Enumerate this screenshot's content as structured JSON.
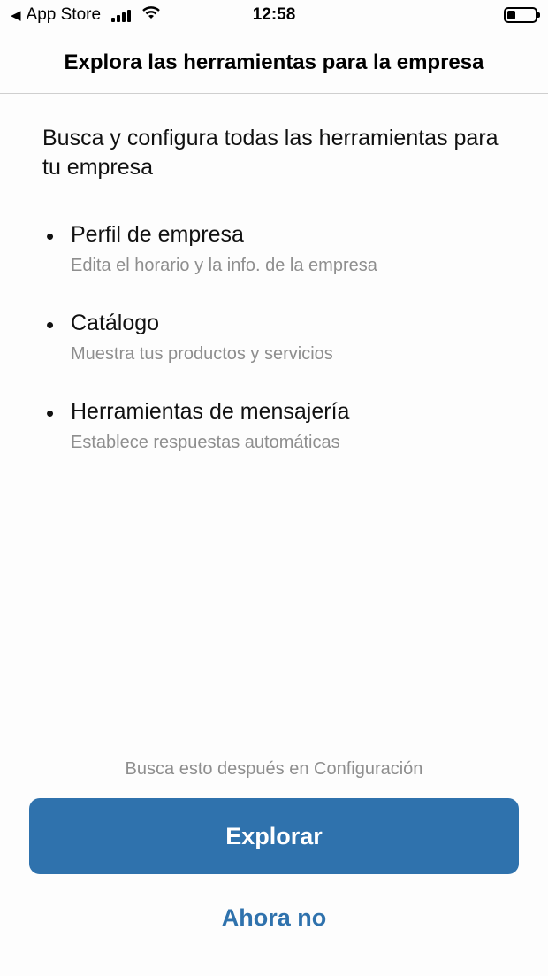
{
  "status_bar": {
    "back_label": "App Store",
    "time": "12:58",
    "back_icon": "back-arrow-icon",
    "signal_icon": "cellular-signal-icon",
    "wifi_icon": "wifi-icon",
    "battery_icon": "battery-icon"
  },
  "header": {
    "title": "Explora las herramientas para la empresa"
  },
  "intro": "Busca y configura todas las herramientas para tu empresa",
  "features": [
    {
      "title": "Perfil de empresa",
      "description": "Edita el horario y la info. de la empresa"
    },
    {
      "title": "Catálogo",
      "description": "Muestra tus productos y servicios"
    },
    {
      "title": "Herramientas de mensajería",
      "description": "Establece respuestas automáticas"
    }
  ],
  "footer": {
    "note": "Busca esto después en Configuración",
    "primary_label": "Explorar",
    "secondary_label": "Ahora no"
  },
  "colors": {
    "accent": "#2f72ad",
    "muted_text": "#8e8e8e",
    "background": "#fdfdfd"
  }
}
